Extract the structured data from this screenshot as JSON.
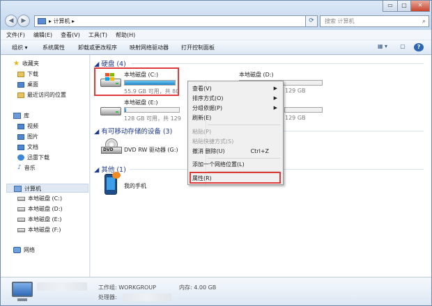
{
  "window": {
    "address": "计算机",
    "address_arrow": "▸",
    "search_placeholder": "搜索 计算机",
    "controls": {
      "minimize": "▭",
      "maximize": "□",
      "close": "✕"
    }
  },
  "menubar": [
    "文件(F)",
    "编辑(E)",
    "查看(V)",
    "工具(T)",
    "帮助(H)"
  ],
  "toolbar": [
    "组织 ▾",
    "系统属性",
    "卸载或更改程序",
    "映射网络驱动器",
    "打开控制面板"
  ],
  "navpane": {
    "favorites": {
      "label": "收藏夹",
      "items": [
        "下载",
        "桌面",
        "最近访问的位置"
      ]
    },
    "libraries": {
      "label": "库",
      "items": [
        "视频",
        "图片",
        "文档",
        "迅雷下载",
        "音乐"
      ]
    },
    "computer": {
      "label": "计算机",
      "items": [
        "本地磁盘 (C:)",
        "本地磁盘 (D:)",
        "本地磁盘 (E:)",
        "本地磁盘 (F:)"
      ]
    },
    "network": {
      "label": "网络"
    }
  },
  "content": {
    "groups": {
      "hdd": "硬盘 (4)",
      "removable": "有可移动存储的设备 (3)",
      "other": "其他 (1)"
    },
    "drives": [
      {
        "name": "本地磁盘 (C:)",
        "size": "55.9 GB 可用，共 80",
        "fill": 0.3
      },
      {
        "name": "本地磁盘 (D:)",
        "size": "129 GB",
        "fill": 0.0
      },
      {
        "name": "本地磁盘 (E:)",
        "size": "128 GB 可用，共 129",
        "fill": 0.01
      },
      {
        "name": "",
        "size": "129 GB",
        "fill": 0.0
      }
    ],
    "dvd": {
      "name": "DVD RW 驱动器 (G:)",
      "label": "DVD"
    },
    "phone": {
      "name": "我的手机"
    }
  },
  "context_menu": [
    {
      "label": "查看(V)",
      "submenu": true
    },
    {
      "label": "排序方式(O)",
      "submenu": true
    },
    {
      "label": "分组依据(P)",
      "submenu": true
    },
    {
      "label": "刷新(E)"
    },
    {
      "label": "粘贴(P)",
      "disabled": true
    },
    {
      "label": "粘贴快捷方式(S)",
      "disabled": true
    },
    {
      "label": "撤消 删除(U)",
      "shortcut": "Ctrl+Z"
    },
    {
      "label": "添加一个网络位置(L)"
    },
    {
      "label": "属性(R)"
    }
  ],
  "details": {
    "workgroup": "工作组: WORKGROUP",
    "memory": "内存: 4.00 GB",
    "processor": "处理器:"
  },
  "colors": {
    "highlight": "#e0393a",
    "group_header": "#1e3a8a",
    "bar_fill": "#1f86c8"
  }
}
